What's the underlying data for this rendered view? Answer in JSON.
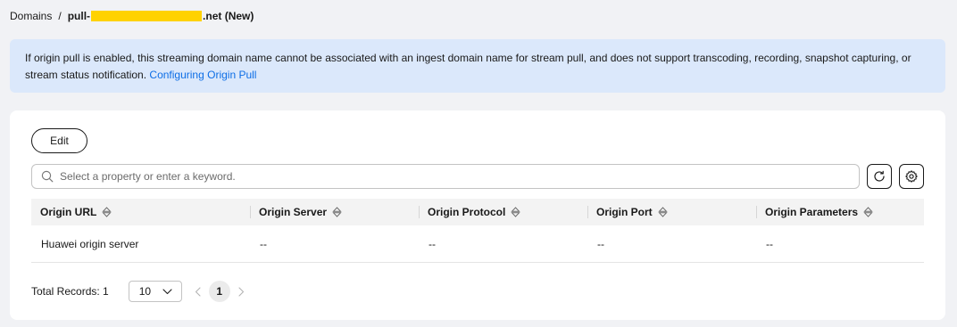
{
  "breadcrumb": {
    "parent": "Domains",
    "separator": "/",
    "current_prefix": "pull-",
    "current_suffix": ".net (New)"
  },
  "alert": {
    "text": "If origin pull is enabled, this streaming domain name cannot be associated with an ingest domain name for stream pull, and does not support transcoding, recording, snapshot capturing, or stream status notification. ",
    "link_text": "Configuring Origin Pull"
  },
  "toolbar": {
    "edit_label": "Edit",
    "search_placeholder": "Select a property or enter a keyword."
  },
  "table": {
    "columns": [
      "Origin URL",
      "Origin Server",
      "Origin Protocol",
      "Origin Port",
      "Origin Parameters"
    ],
    "rows": [
      [
        "Huawei origin server",
        "--",
        "--",
        "--",
        "--"
      ]
    ]
  },
  "pagination": {
    "total": "Total Records: 1",
    "page_size": "10",
    "current_page": "1"
  },
  "colors": {
    "accent_link": "#0d6ee6",
    "alert_bg": "#dbe8fb",
    "redaction": "#ffd200"
  }
}
